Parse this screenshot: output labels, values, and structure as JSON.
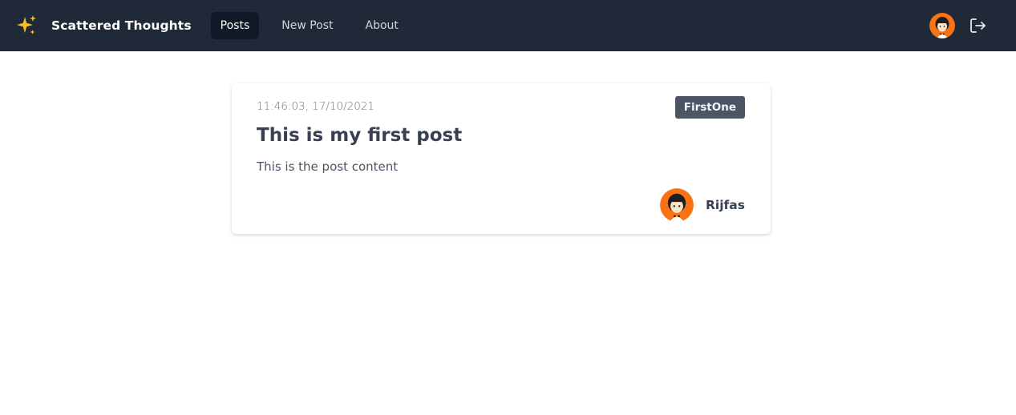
{
  "app": {
    "name": "Scattered Thoughts",
    "logo_icon": "sparkles-icon",
    "accent_color": "#fbbf24"
  },
  "nav": {
    "links": [
      {
        "label": "Posts",
        "active": true
      },
      {
        "label": "New Post",
        "active": false
      },
      {
        "label": "About",
        "active": false
      }
    ],
    "user_avatar_icon": "user-avatar",
    "logout_icon": "logout-icon"
  },
  "post": {
    "date": "11:46:03, 17/10/2021",
    "tag": "FirstOne",
    "title": "This is my first post",
    "content": "This is the post content",
    "author": {
      "name": "Rijfas",
      "avatar_icon": "author-avatar"
    }
  },
  "colors": {
    "navbar_bg": "#1f2937",
    "active_link_bg": "#111827",
    "tag_bg": "#4b5563",
    "avatar_bg": "#f97316"
  }
}
